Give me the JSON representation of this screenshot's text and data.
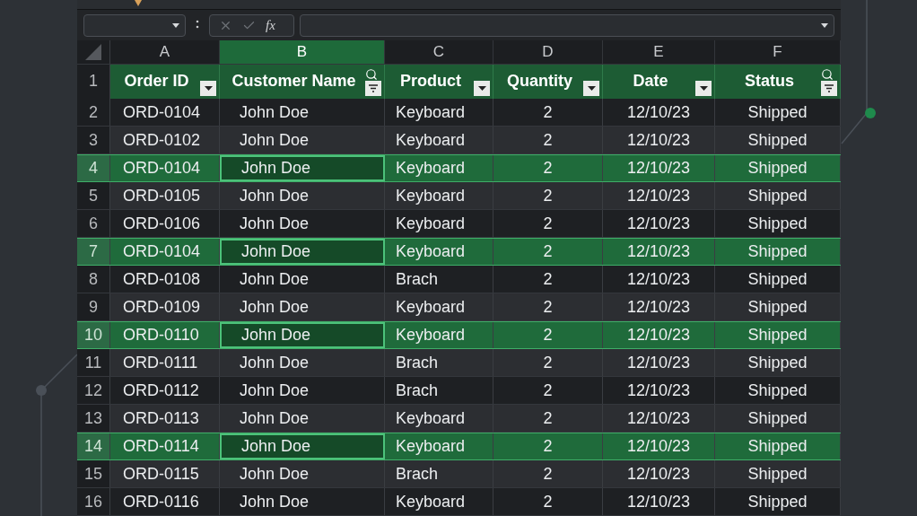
{
  "formula_bar": {
    "fx_label": "fx"
  },
  "column_letters": [
    {
      "label": "A",
      "selected": false
    },
    {
      "label": "B",
      "selected": true
    },
    {
      "label": "C",
      "selected": false
    },
    {
      "label": "D",
      "selected": false
    },
    {
      "label": "E",
      "selected": false
    },
    {
      "label": "F",
      "selected": false
    }
  ],
  "header_row": {
    "number": "1",
    "cells": [
      {
        "label": "Order ID",
        "kind": "dropdown"
      },
      {
        "label": "Customer Name",
        "kind": "search-filter"
      },
      {
        "label": "Product",
        "kind": "dropdown"
      },
      {
        "label": "Quantity",
        "kind": "dropdown"
      },
      {
        "label": "Date",
        "kind": "dropdown"
      },
      {
        "label": "Status",
        "kind": "search-filter"
      }
    ]
  },
  "rows": [
    {
      "number": "2",
      "selected": false,
      "cells": [
        "ORD-0104",
        "John Doe",
        "Keyboard",
        "2",
        "12/10/23",
        "Shipped"
      ]
    },
    {
      "number": "3",
      "selected": false,
      "cells": [
        "ORD-0102",
        "John Doe",
        "Keyboard",
        "2",
        "12/10/23",
        "Shipped"
      ]
    },
    {
      "number": "4",
      "selected": true,
      "cells": [
        "ORD-0104",
        "John Doe",
        "Keyboard",
        "2",
        "12/10/23",
        "Shipped"
      ]
    },
    {
      "number": "5",
      "selected": false,
      "cells": [
        "ORD-0105",
        "John Doe",
        "Keyboard",
        "2",
        "12/10/23",
        "Shipped"
      ]
    },
    {
      "number": "6",
      "selected": false,
      "cells": [
        "ORD-0106",
        "John Doe",
        "Keyboard",
        "2",
        "12/10/23",
        "Shipped"
      ]
    },
    {
      "number": "7",
      "selected": true,
      "cells": [
        "ORD-0104",
        "John Doe",
        "Keyboard",
        "2",
        "12/10/23",
        "Shipped"
      ]
    },
    {
      "number": "8",
      "selected": false,
      "cells": [
        "ORD-0108",
        "John Doe",
        "Brach",
        "2",
        "12/10/23",
        "Shipped"
      ]
    },
    {
      "number": "9",
      "selected": false,
      "cells": [
        "ORD-0109",
        "John Doe",
        "Keyboard",
        "2",
        "12/10/23",
        "Shipped"
      ]
    },
    {
      "number": "10",
      "selected": true,
      "cells": [
        "ORD-0110",
        "John Doe",
        "Keyboard",
        "2",
        "12/10/23",
        "Shipped"
      ]
    },
    {
      "number": "11",
      "selected": false,
      "cells": [
        "ORD-0111",
        "John Doe",
        "Brach",
        "2",
        "12/10/23",
        "Shipped"
      ]
    },
    {
      "number": "12",
      "selected": false,
      "cells": [
        "ORD-0112",
        "John Doe",
        "Brach",
        "2",
        "12/10/23",
        "Shipped"
      ]
    },
    {
      "number": "13",
      "selected": false,
      "cells": [
        "ORD-0113",
        "John Doe",
        "Keyboard",
        "2",
        "12/10/23",
        "Shipped"
      ]
    },
    {
      "number": "14",
      "selected": true,
      "cells": [
        "ORD-0114",
        "John Doe",
        "Keyboard",
        "2",
        "12/10/23",
        "Shipped"
      ]
    },
    {
      "number": "15",
      "selected": false,
      "cells": [
        "ORD-0115",
        "John Doe",
        "Brach",
        "2",
        "12/10/23",
        "Shipped"
      ]
    },
    {
      "number": "16",
      "selected": false,
      "cells": [
        "ORD-0116",
        "John Doe",
        "Keyboard",
        "2",
        "12/10/23",
        "Shipped"
      ]
    }
  ]
}
